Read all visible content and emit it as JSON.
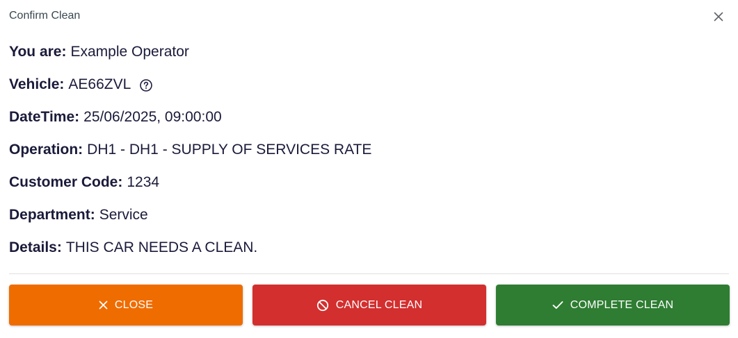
{
  "dialog": {
    "title": "Confirm Clean"
  },
  "details": {
    "operator": {
      "label": "You are:",
      "value": "Example Operator"
    },
    "vehicle": {
      "label": "Vehicle:",
      "value": "AE66ZVL"
    },
    "datetime": {
      "label": "DateTime:",
      "value": "25/06/2025, 09:00:00"
    },
    "operation": {
      "label": "Operation:",
      "value": "DH1 - DH1 - SUPPLY OF SERVICES RATE"
    },
    "customer_code": {
      "label": "Customer Code:",
      "value": "1234"
    },
    "department": {
      "label": "Department:",
      "value": "Service"
    },
    "notes": {
      "label": "Details:",
      "value": "THIS CAR NEEDS A CLEAN."
    }
  },
  "actions": {
    "close_label": "CLOSE",
    "cancel_label": "CANCEL CLEAN",
    "complete_label": "COMPLETE CLEAN"
  },
  "icons": {
    "dialog_close": "close-icon",
    "vehicle_help": "help-circle-icon",
    "close_button": "close-icon",
    "cancel_button": "block-icon",
    "complete_button": "check-icon"
  },
  "colors": {
    "close_button": "#ef6c00",
    "cancel_button": "#d32f2f",
    "complete_button": "#2e7d32",
    "text": "#1a1a3a"
  }
}
